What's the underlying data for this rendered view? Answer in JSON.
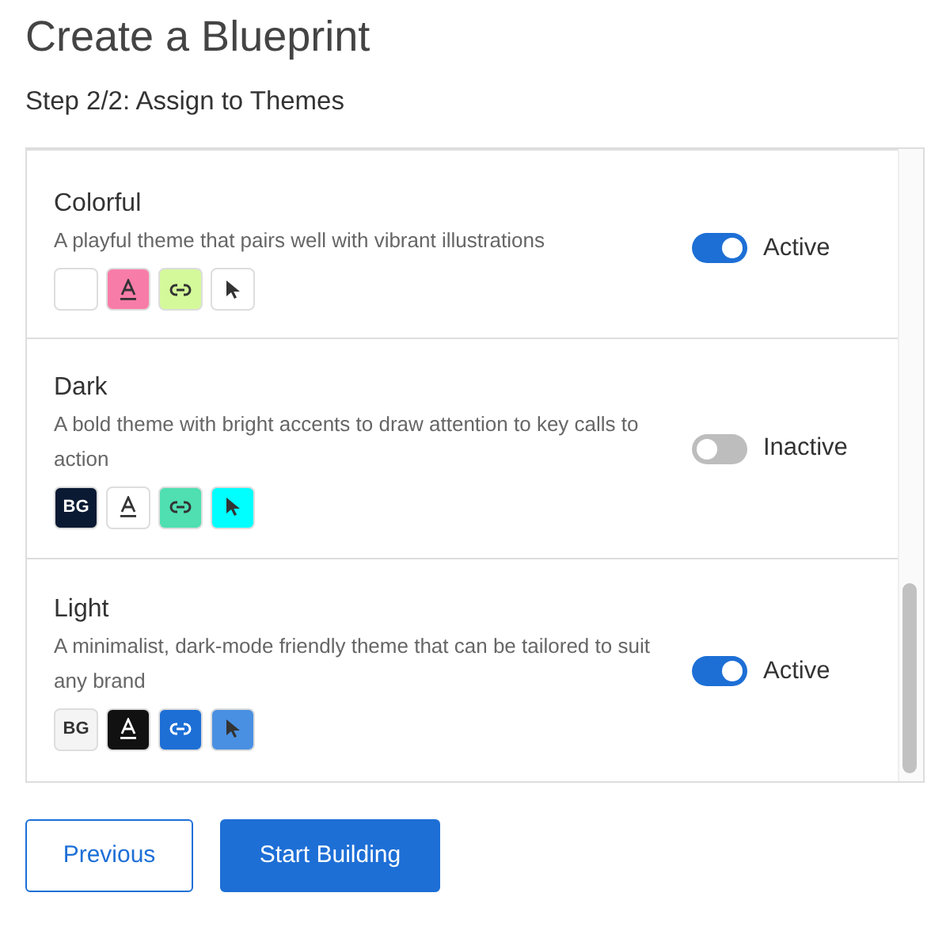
{
  "title": "Create a Blueprint",
  "subtitle": "Step 2/2: Assign to Themes",
  "themes": [
    {
      "name": "Colorful",
      "description": "A playful theme that pairs well with vibrant illustrations",
      "active": true,
      "status": "Active",
      "swatches": [
        {
          "kind": "background",
          "color": "#ffffff"
        },
        {
          "kind": "text",
          "color": "#f87ca8"
        },
        {
          "kind": "link",
          "color": "#d4f99a"
        },
        {
          "kind": "cursor",
          "color": "#ffffff"
        }
      ]
    },
    {
      "name": "Dark",
      "description": "A bold theme with bright accents to draw attention to key calls to action",
      "active": false,
      "status": "Inactive",
      "swatches": [
        {
          "kind": "background",
          "color": "#0b1a33",
          "label": "BG"
        },
        {
          "kind": "text",
          "color": "#ffffff"
        },
        {
          "kind": "link",
          "color": "#4fdfb0"
        },
        {
          "kind": "cursor",
          "color": "#00ffff"
        }
      ]
    },
    {
      "name": "Light",
      "description": "A minimalist, dark-mode friendly theme that can be tailored to suit any brand",
      "active": true,
      "status": "Active",
      "swatches": [
        {
          "kind": "background",
          "color": "#f4f4f4",
          "label": "BG"
        },
        {
          "kind": "text",
          "color": "#111111"
        },
        {
          "kind": "link",
          "color": "#1d6fd6"
        },
        {
          "kind": "cursor",
          "color": "#4a90e2"
        }
      ]
    }
  ],
  "buttons": [
    {
      "label": "Previous",
      "kind": "secondary"
    },
    {
      "label": "Start Building",
      "kind": "primary"
    }
  ]
}
